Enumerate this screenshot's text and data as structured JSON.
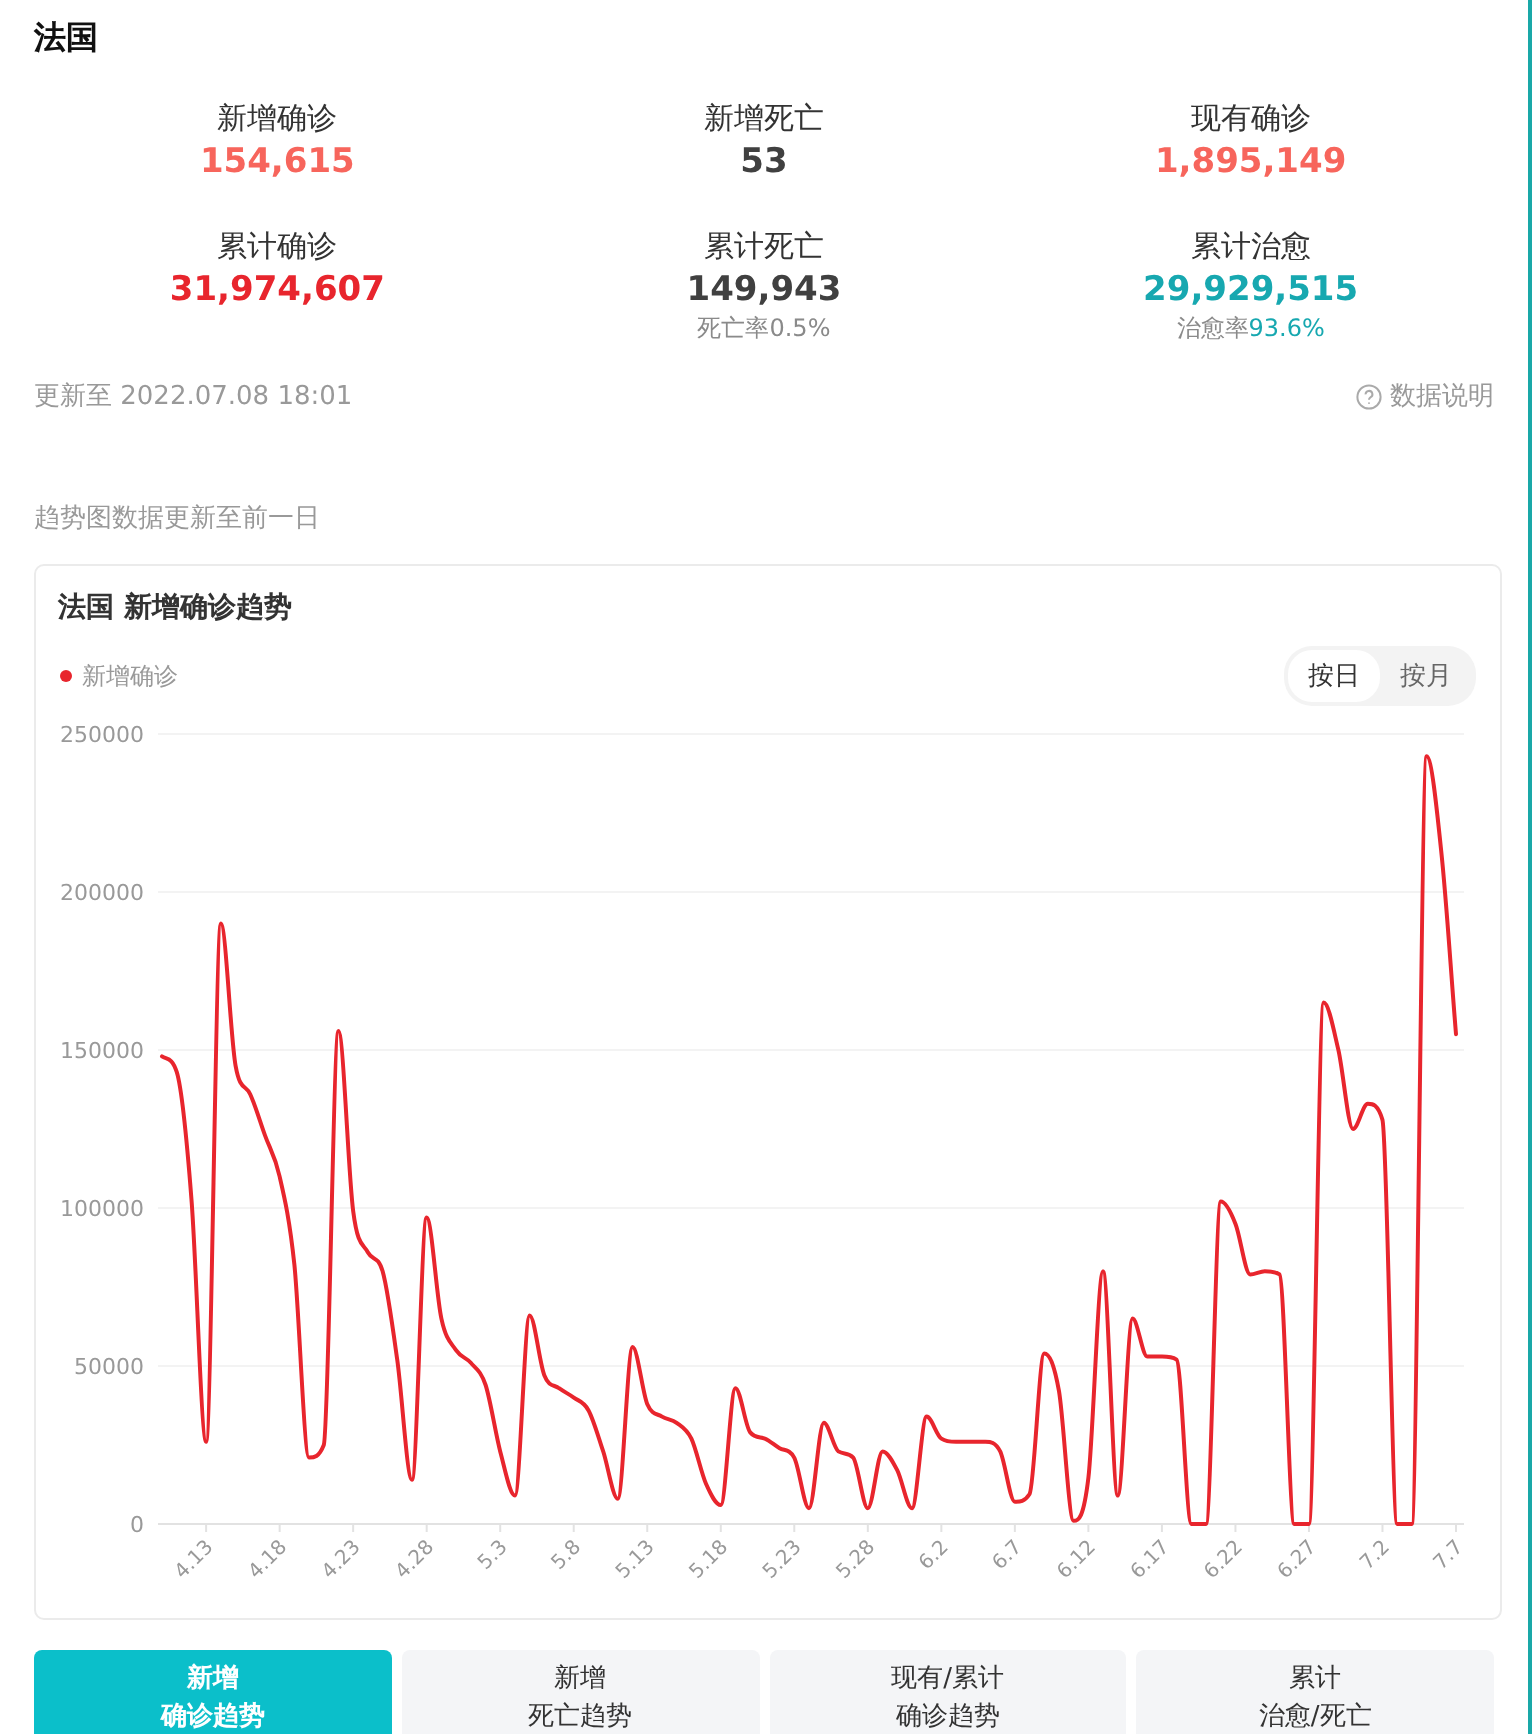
{
  "country": "法国",
  "stats": [
    {
      "label": "新增确诊",
      "value": "154,615",
      "color": "#f7655c"
    },
    {
      "label": "新增死亡",
      "value": "53",
      "color": "#404040"
    },
    {
      "label": "现有确诊",
      "value": "1,895,149",
      "color": "#f7655c"
    },
    {
      "label": "累计确诊",
      "value": "31,974,607",
      "color": "#e8252d"
    },
    {
      "label": "累计死亡",
      "value": "149,943",
      "color": "#404040",
      "note": {
        "label": "死亡率",
        "value": "0.5%",
        "color": "#8a8a8a"
      }
    },
    {
      "label": "累计治愈",
      "value": "29,929,515",
      "color": "#17a8b0",
      "note": {
        "label": "治愈率",
        "value": "93.6%",
        "color": "#17a8b0"
      }
    }
  ],
  "updated": "更新至 2022.07.08 18:01",
  "data_note": "数据说明",
  "trend_note": "趋势图数据更新至前一日",
  "chart_card": {
    "title": "法国 新增确诊趋势",
    "toggle": [
      {
        "label": "按日",
        "selected": true
      },
      {
        "label": "按月",
        "selected": false
      }
    ],
    "chart_data": {
      "type": "line",
      "categories": [
        null,
        null,
        null,
        "4.13",
        null,
        null,
        null,
        null,
        "4.18",
        null,
        null,
        null,
        null,
        "4.23",
        null,
        null,
        null,
        null,
        "4.28",
        null,
        null,
        null,
        null,
        "5.3",
        null,
        null,
        null,
        null,
        "5.8",
        null,
        null,
        null,
        null,
        "5.13",
        null,
        null,
        null,
        null,
        "5.18",
        null,
        null,
        null,
        null,
        "5.23",
        null,
        null,
        null,
        null,
        "5.28",
        null,
        null,
        null,
        null,
        "6.2",
        null,
        null,
        null,
        null,
        "6.7",
        null,
        null,
        null,
        null,
        "6.12",
        null,
        null,
        null,
        null,
        "6.17",
        null,
        null,
        null,
        null,
        "6.22",
        null,
        null,
        null,
        null,
        "6.27",
        null,
        null,
        null,
        null,
        "7.2",
        null,
        null,
        null,
        null,
        "7.7"
      ],
      "grid": true,
      "series": [
        {
          "name": "新增确诊",
          "color": "#e8252d",
          "values": [
            148000,
            143000,
            103000,
            26000,
            190000,
            145000,
            136000,
            123000,
            110000,
            82000,
            21000,
            25000,
            156000,
            99000,
            86000,
            80000,
            52000,
            14000,
            97000,
            65000,
            55000,
            51000,
            44000,
            23000,
            9000,
            66000,
            47000,
            43000,
            40000,
            36000,
            23000,
            8000,
            56000,
            38000,
            34000,
            32000,
            27000,
            12700,
            6000,
            43000,
            29000,
            27000,
            24000,
            21000,
            5000,
            32000,
            23000,
            21000,
            5000,
            23000,
            17000,
            5000,
            34000,
            27000,
            26000,
            26000,
            26000,
            23000,
            7000,
            9500,
            54000,
            42000,
            1000,
            14600,
            80000,
            9000,
            65000,
            53000,
            53000,
            52000,
            0,
            0,
            102000,
            95000,
            79000,
            80000,
            79000,
            0,
            0,
            165000,
            150000,
            125000,
            133000,
            128000,
            0,
            0,
            243000,
            213000,
            155000
          ]
        }
      ],
      "ylim": [
        0,
        250000
      ],
      "yticks": [
        0,
        50000,
        100000,
        150000,
        200000,
        250000
      ]
    }
  },
  "tabs": [
    {
      "lines": [
        "新增",
        "确诊趋势"
      ],
      "selected": true
    },
    {
      "lines": [
        "新增",
        "死亡趋势"
      ],
      "selected": false
    },
    {
      "lines": [
        "现有/累计",
        "确诊趋势"
      ],
      "selected": false
    },
    {
      "lines": [
        "累计",
        "治愈/死亡"
      ],
      "selected": false
    }
  ]
}
